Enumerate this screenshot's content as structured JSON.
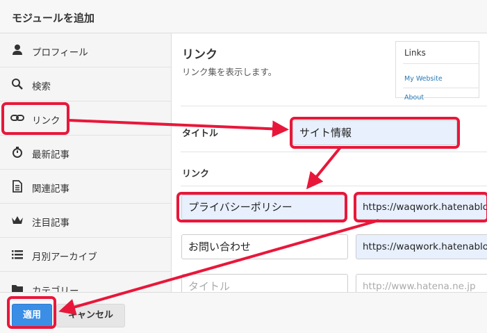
{
  "dialog": {
    "title": "モジュールを追加"
  },
  "sidebar": {
    "items": [
      {
        "label": "プロフィール",
        "icon": "person-icon"
      },
      {
        "label": "検索",
        "icon": "search-icon"
      },
      {
        "label": "リンク",
        "icon": "link-icon"
      },
      {
        "label": "最新記事",
        "icon": "stopwatch-icon"
      },
      {
        "label": "関連記事",
        "icon": "document-icon"
      },
      {
        "label": "注目記事",
        "icon": "crown-icon"
      },
      {
        "label": "月別アーカイブ",
        "icon": "list-icon"
      },
      {
        "label": "カテゴリー",
        "icon": "folder-icon"
      }
    ]
  },
  "module": {
    "title": "リンク",
    "description": "リンク集を表示します。",
    "preview": {
      "title": "Links",
      "links": [
        "My Website",
        "About"
      ]
    }
  },
  "form": {
    "title_label": "タイトル",
    "title_value": "サイト情報",
    "links_label": "リンク",
    "links": [
      {
        "name": "プライバシーポリシー",
        "url": "https://waqwork.hatenablog."
      },
      {
        "name": "お問い合わせ",
        "url": "https://waqwork.hatenablog."
      }
    ],
    "new_link_placeholder": {
      "name": "タイトル",
      "url": "http://www.hatena.ne.jp"
    }
  },
  "footer": {
    "apply_label": "適用",
    "cancel_label": "キャンセル"
  },
  "colors": {
    "annotation": "#e8173a",
    "primary_button": "#3a8ee6",
    "link": "#2a7ab5",
    "filled_input": "#e8f0fe"
  }
}
